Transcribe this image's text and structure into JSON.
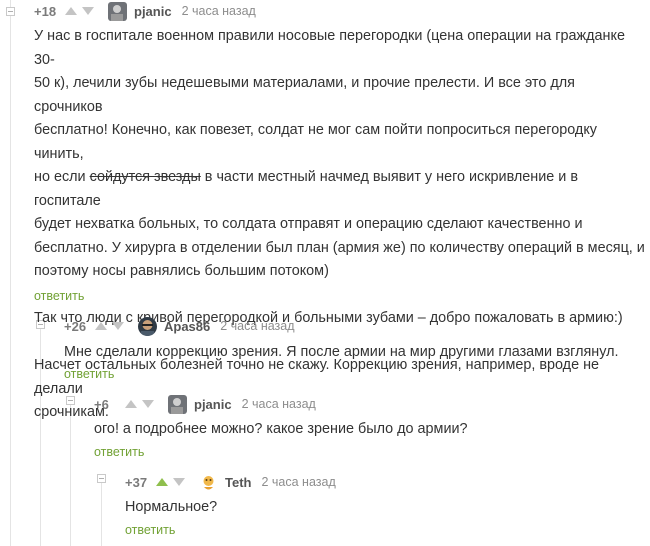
{
  "comments": [
    {
      "rating": "+18",
      "author": "pjanic",
      "time": "2 часа назад",
      "text_part1": "У нас в госпитале военном правили носовые перегородки (цена операции на гражданке 30-\n50 к), лечили зубы недешевыми материалами, и прочие прелести. И все это для срочников\nбесплатно! Конечно, как повезет, солдат не мог сам пойти попроситься перегородку чинить,\nно если ",
      "text_strike": "сойдутся звезды",
      "text_part2": " в части местный начмед выявит у него искривление и в госпитале\nбудет нехватка больных, то солдата отправят и операцию сделают качественно и\nбесплатно. У хирурга в отделении был план (армия же) по количеству операций в месяц, и\nпоэтому носы равнялись большим потоком)\n\nТак что люди с кривой перегородкой и больными зубами – добро пожаловать в армию:)\n\nНасчет остальных болезней точно не скажу. Коррекцию зрения, например, вроде не делали\nсрочникам.",
      "reply": "ответить"
    },
    {
      "rating": "+26",
      "author": "Apas86",
      "time": "2 часа назад",
      "text": "Мне сделали коррекцию зрения. Я после армии на мир другими глазами взглянул.",
      "reply": "ответить"
    },
    {
      "rating": "+6",
      "author": "pjanic",
      "time": "2 часа назад",
      "text": "ого! а подробнее можно? какое зрение было до армии?",
      "reply": "ответить"
    },
    {
      "rating": "+37",
      "author": "Teth",
      "time": "2 часа назад",
      "text": "Нормальное?",
      "reply": "ответить",
      "upvoted": true
    }
  ],
  "colors": {
    "accent_green": "#71a134",
    "arrow_gray": "#c4c4c4",
    "rail": "#e4e4e4"
  },
  "icons": [
    "arrow-up-icon",
    "arrow-down-icon",
    "collapse-icon"
  ]
}
